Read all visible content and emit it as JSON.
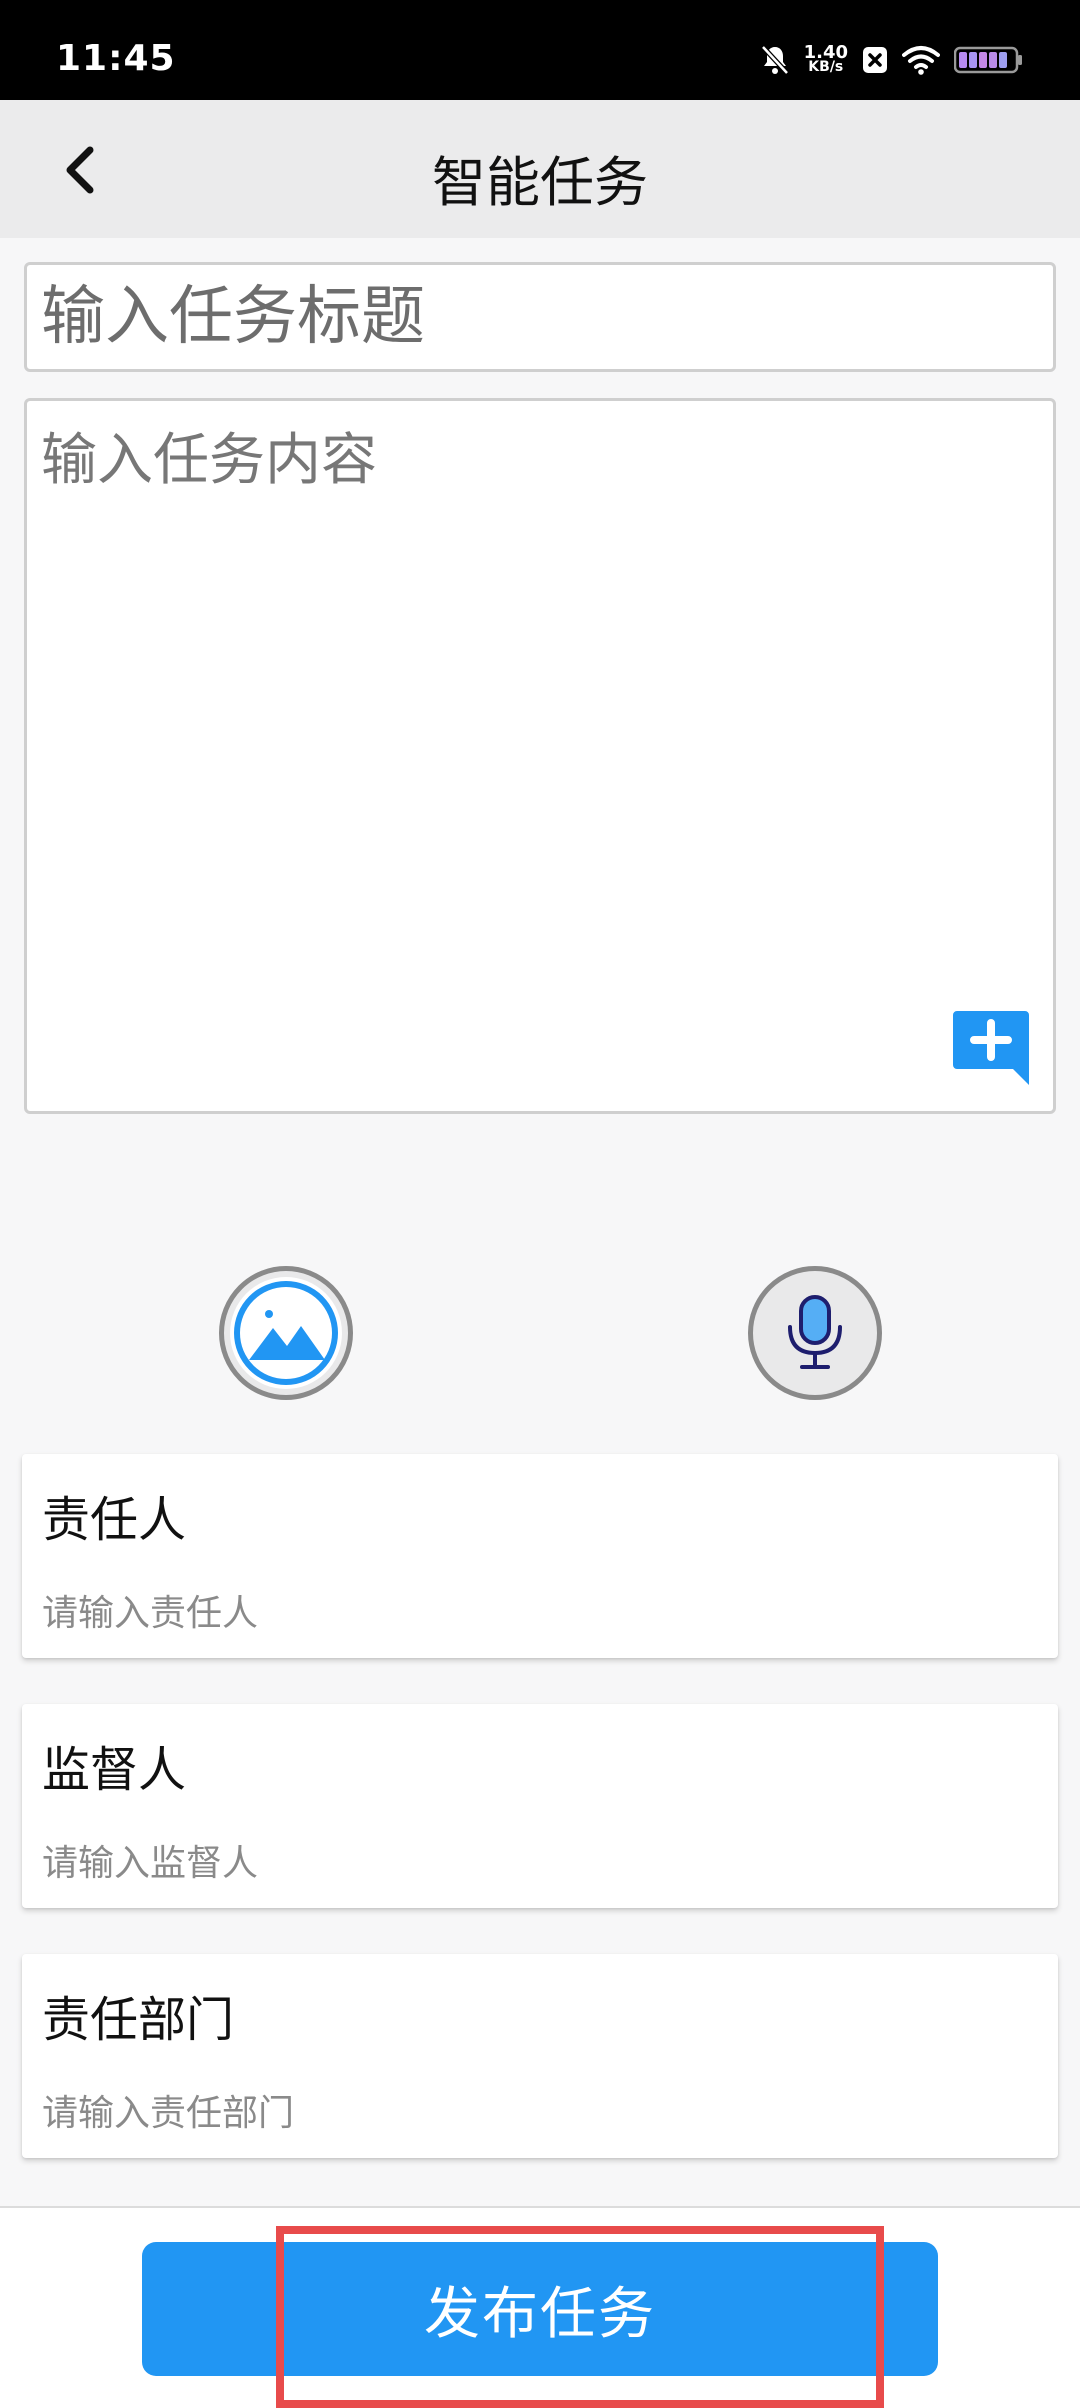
{
  "status_bar": {
    "time": "11:45",
    "net_speed_value": "1.40",
    "net_speed_unit": "KB/s",
    "icons": [
      "mute-bell-icon",
      "close-box-icon",
      "wifi-icon",
      "battery-icon"
    ]
  },
  "header": {
    "title": "智能任务",
    "back_icon": "chevron-left-icon"
  },
  "form": {
    "title_placeholder": "输入任务标题",
    "content_placeholder": "输入任务内容",
    "fields": [
      {
        "label": "责任人",
        "placeholder": "请输入责任人"
      },
      {
        "label": "监督人",
        "placeholder": "请输入监督人"
      },
      {
        "label": "责任部门",
        "placeholder": "请输入责任部门"
      }
    ]
  },
  "media": {
    "image_icon": "image-picker-icon",
    "voice_icon": "microphone-icon"
  },
  "footer": {
    "publish_label": "发布任务"
  },
  "colors": {
    "accent": "#2196f3",
    "highlight": "#e84b4b",
    "mic": "#3a3aa0"
  }
}
